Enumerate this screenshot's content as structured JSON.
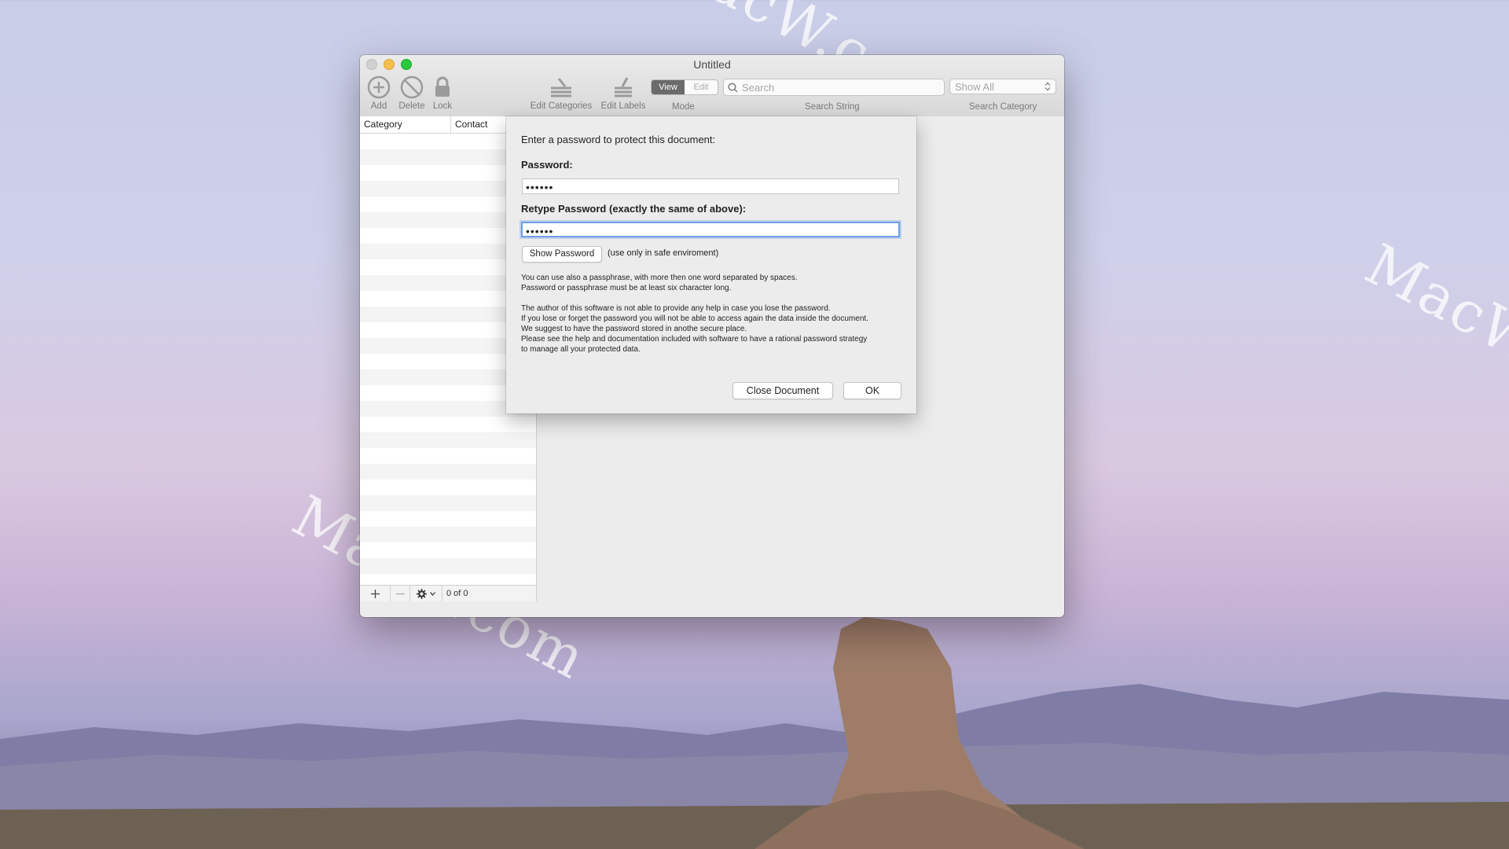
{
  "window": {
    "title": "Untitled"
  },
  "toolbar": {
    "add_label": "Add",
    "delete_label": "Delete",
    "lock_label": "Lock",
    "edit_categories_label": "Edit Categories",
    "edit_labels_label": "Edit Labels",
    "mode_view": "View",
    "mode_edit": "Edit",
    "mode_caption": "Mode",
    "search_placeholder": "Search",
    "search_caption": "Search String",
    "category_value": "Show All",
    "category_caption": "Search Category"
  },
  "list": {
    "columns": [
      "Category",
      "Contact"
    ],
    "count_text": "0 of 0"
  },
  "dialog": {
    "prompt": "Enter a password to protect this document:",
    "password_label": "Password:",
    "password_value": "••••••",
    "retype_label": "Retype Password (exactly the same of above):",
    "retype_value": "••••••",
    "show_password_label": "Show Password",
    "safe_note": "(use only in safe enviroment)",
    "info_1": "You can use also a passphrase, with more then one word separated by spaces.\nPassword or passphrase must be at least six character long.",
    "info_2": "The author of this software is not able to provide any help in case you lose the password.\nIf you lose or forget the password you will not be able to access again the data inside the document.\nWe suggest to have the password stored in anothe secure place.\nPlease see the help and documentation included with software to have a rational password strategy\nto manage all your protected data.",
    "close_label": "Close Document",
    "ok_label": "OK"
  },
  "watermark": "MacW.com",
  "colors": {
    "focus_ring": "#6f9ee8",
    "close_light": "#d0d0d0",
    "min_light": "#f5bf4f",
    "zoom_light": "#28c940"
  }
}
